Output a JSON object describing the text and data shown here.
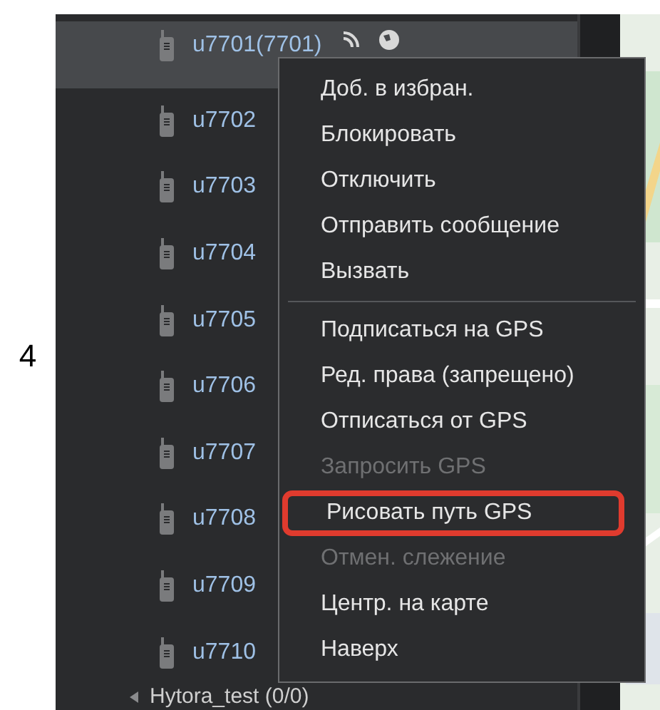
{
  "label": "4",
  "tree": {
    "items": [
      {
        "name": "u7701(7701)",
        "selected": true,
        "status_icons": true
      },
      {
        "name": "u7702",
        "selected": false,
        "status_icons": false
      },
      {
        "name": "u7703",
        "selected": false,
        "status_icons": false
      },
      {
        "name": "u7704",
        "selected": false,
        "status_icons": false
      },
      {
        "name": "u7705",
        "selected": false,
        "status_icons": false
      },
      {
        "name": "u7706",
        "selected": false,
        "status_icons": false
      },
      {
        "name": "u7707",
        "selected": false,
        "status_icons": false
      },
      {
        "name": "u7708",
        "selected": false,
        "status_icons": false
      },
      {
        "name": "u7709",
        "selected": false,
        "status_icons": false
      },
      {
        "name": "u7710",
        "selected": false,
        "status_icons": false
      }
    ],
    "group": "Hytora_test (0/0)"
  },
  "context_menu": {
    "sections": [
      [
        {
          "label": "Доб. в избран.",
          "disabled": false,
          "highlighted": false
        },
        {
          "label": "Блокировать",
          "disabled": false,
          "highlighted": false
        },
        {
          "label": "Отключить",
          "disabled": false,
          "highlighted": false
        },
        {
          "label": "Отправить сообщение",
          "disabled": false,
          "highlighted": false
        },
        {
          "label": "Вызвать",
          "disabled": false,
          "highlighted": false
        }
      ],
      [
        {
          "label": "Подписаться на GPS",
          "disabled": false,
          "highlighted": false
        },
        {
          "label": "Ред. права (запрещено)",
          "disabled": false,
          "highlighted": false
        },
        {
          "label": "Отписаться от GPS",
          "disabled": false,
          "highlighted": false
        },
        {
          "label": "Запросить GPS",
          "disabled": true,
          "highlighted": false
        },
        {
          "label": "Рисовать путь GPS",
          "disabled": false,
          "highlighted": true
        },
        {
          "label": "Отмен. слежение",
          "disabled": true,
          "highlighted": false
        },
        {
          "label": "Центр. на карте",
          "disabled": false,
          "highlighted": false
        },
        {
          "label": "Наверх",
          "disabled": false,
          "highlighted": false
        }
      ]
    ]
  }
}
